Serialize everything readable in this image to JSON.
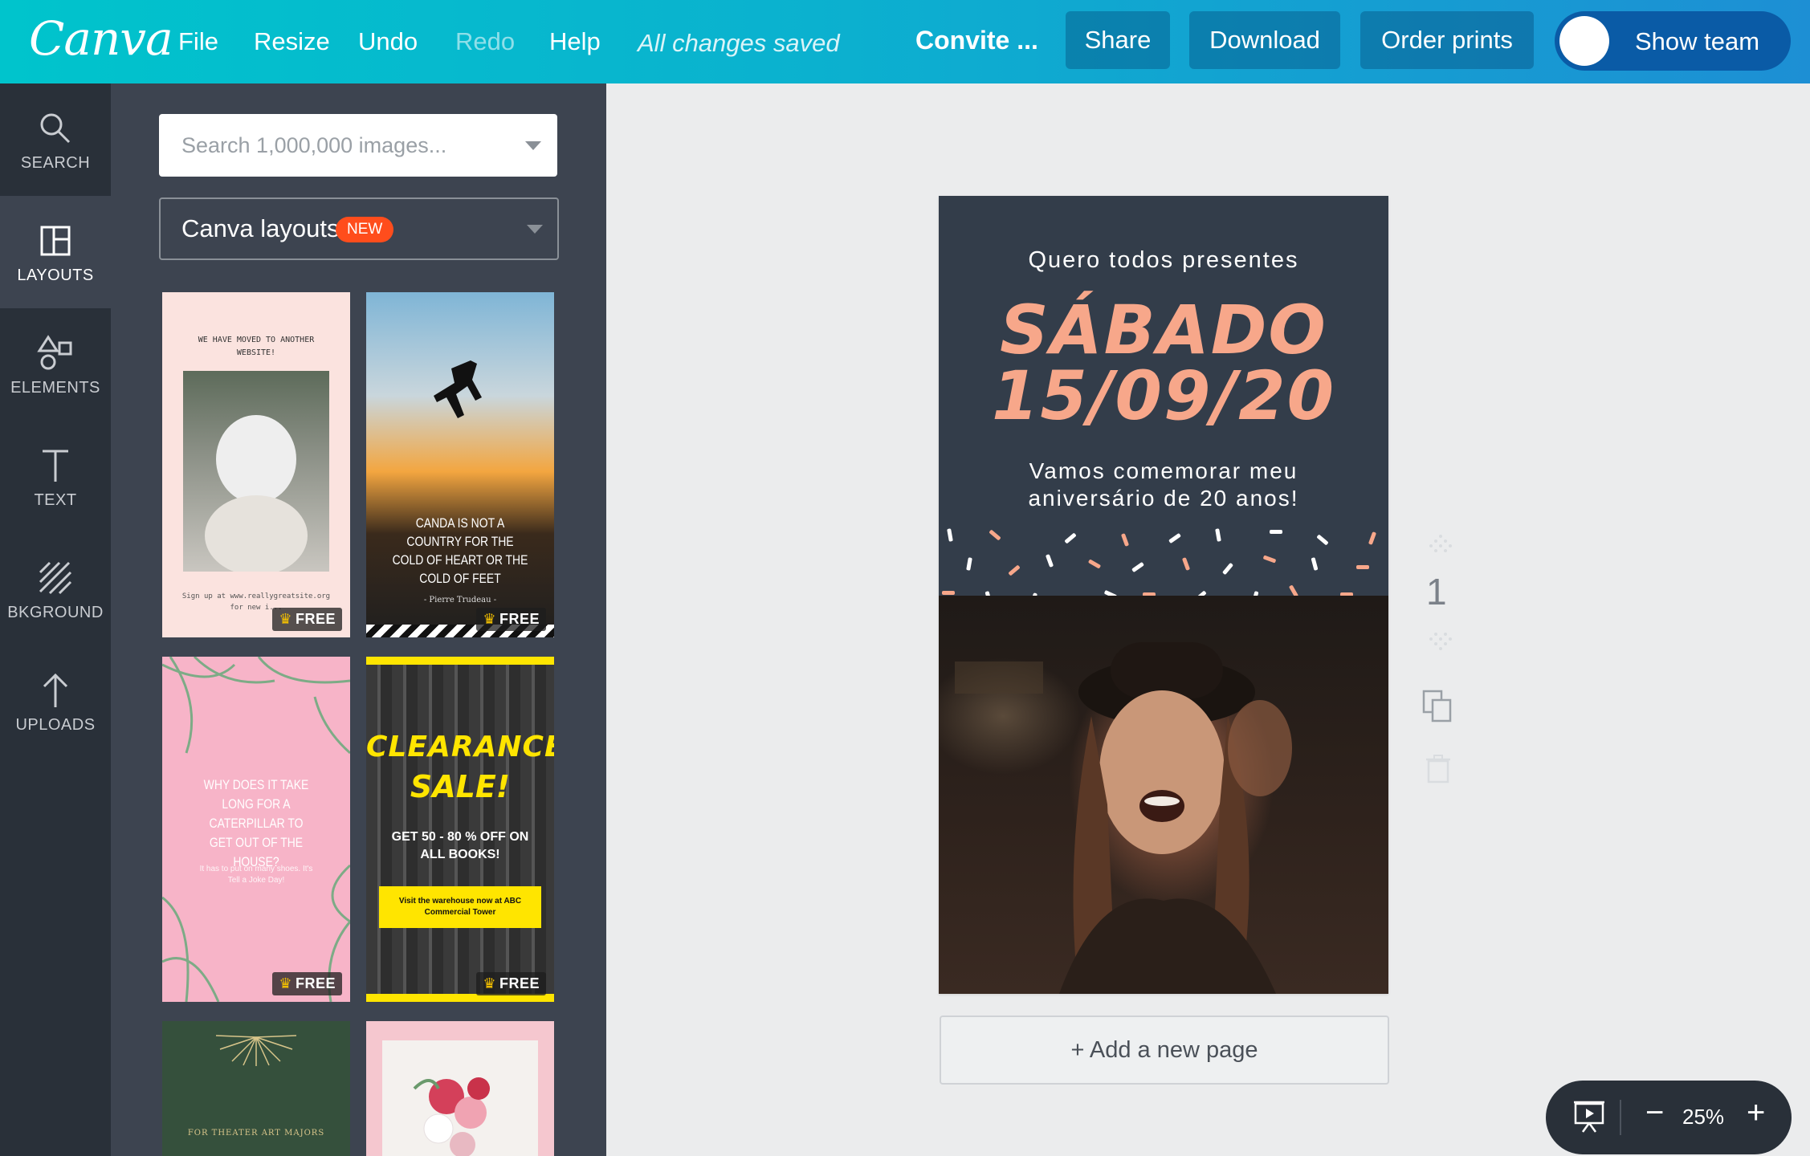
{
  "topbar": {
    "logo": "Canva",
    "menu": [
      "File",
      "Resize",
      "Undo",
      "Redo",
      "Help"
    ],
    "save_status": "All changes saved",
    "doc_title": "Convite ...",
    "share": "Share",
    "download": "Download",
    "order_prints": "Order prints",
    "show_team": "Show team"
  },
  "rail": [
    {
      "label": "SEARCH",
      "icon": "search-icon"
    },
    {
      "label": "LAYOUTS",
      "icon": "layouts-icon",
      "active": true
    },
    {
      "label": "ELEMENTS",
      "icon": "elements-icon"
    },
    {
      "label": "TEXT",
      "icon": "text-icon"
    },
    {
      "label": "BKGROUND",
      "icon": "background-icon"
    },
    {
      "label": "UPLOADS",
      "icon": "upload-icon"
    }
  ],
  "panel": {
    "search_placeholder": "Search 1,000,000 images...",
    "layouts_select": "Canva layouts",
    "new_badge": "NEW",
    "free_label": "FREE",
    "thumbs": {
      "moved": {
        "title": "WE HAVE MOVED TO ANOTHER WEBSITE!",
        "footer": "Sign up at www.reallygreatsite.org for new i..."
      },
      "canada": {
        "title": "CANDA IS NOT A COUNTRY FOR THE COLD OF HEART OR THE COLD OF FEET",
        "author": "- Pierre Trudeau -"
      },
      "caterpillar": {
        "title": "WHY DOES IT TAKE LONG FOR A CATERPILLAR TO GET OUT OF THE HOUSE?",
        "sub": "It has to put on many shoes. It's Tell a Joke Day!"
      },
      "clearance": {
        "title1": "CLEARANCE",
        "title2": "SALE!",
        "offer": "GET 50 - 80 % OFF ON ALL BOOKS!",
        "banner": "Visit the warehouse now at ABC Commercial Tower"
      },
      "theater": {
        "caption": "FOR THEATER ART MAJORS"
      }
    }
  },
  "design": {
    "top_line": "Quero todos presentes",
    "day": "SÁBADO",
    "date": "15/09/20",
    "sub1": "Vamos comemorar meu",
    "sub2": "aniversário de 20 anos!",
    "accent": "#f7a78a",
    "bg": "#333d4a"
  },
  "page_number": "1",
  "add_page": "+ Add a new page",
  "zoom": "25%",
  "colors": {
    "topbar_start": "#00c4cc",
    "topbar_end": "#1d8fd4",
    "rail": "#293039",
    "panel": "#3d4450"
  }
}
